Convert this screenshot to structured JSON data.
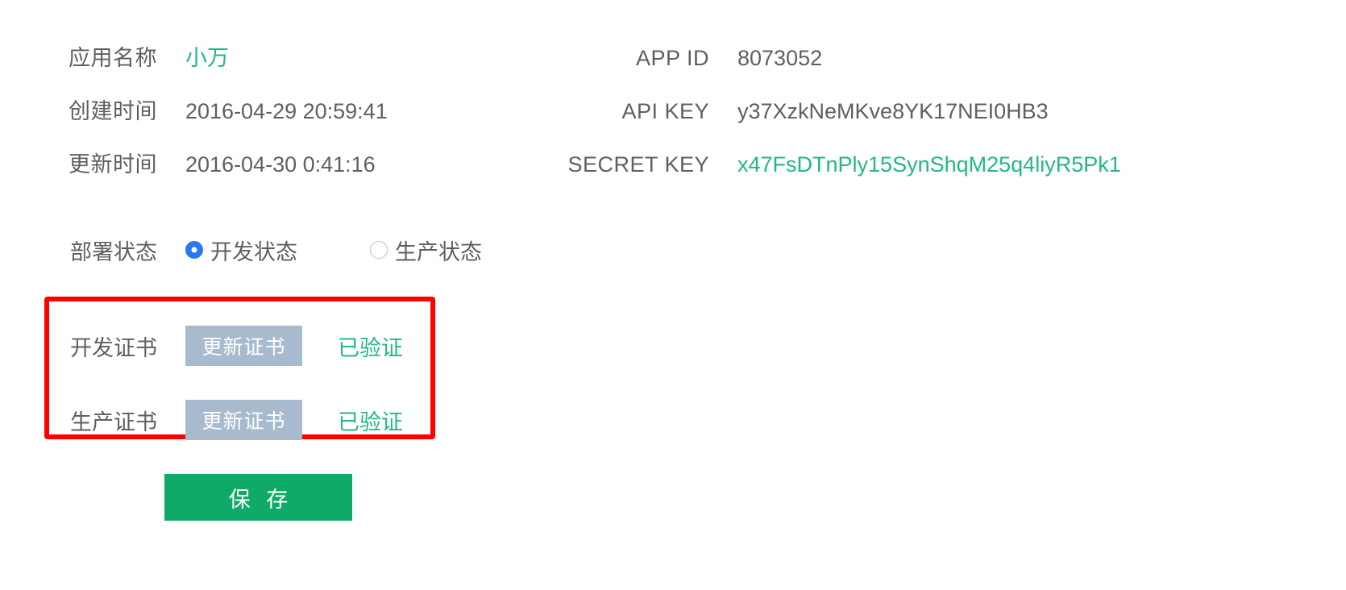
{
  "app_info": {
    "name_label": "应用名称",
    "name_value": "小万",
    "created_label": "创建时间",
    "created_value": "2016-04-29 20:59:41",
    "updated_label": "更新时间",
    "updated_value": "2016-04-30 0:41:16",
    "app_id_label": "APP ID",
    "app_id_value": "8073052",
    "api_key_label": "API KEY",
    "api_key_value": "y37XzkNeMKve8YK17NEI0HB3",
    "secret_key_label": "SECRET KEY",
    "secret_key_value": "x47FsDTnPly15SynShqM25q4liyR5Pk1"
  },
  "deploy": {
    "label": "部署状态",
    "options": [
      {
        "label": "开发状态",
        "selected": true
      },
      {
        "label": "生产状态",
        "selected": false
      }
    ]
  },
  "certificates": {
    "rows": [
      {
        "label": "开发证书",
        "button_label": "更新证书",
        "status": "已验证"
      },
      {
        "label": "生产证书",
        "button_label": "更新证书",
        "status": "已验证"
      }
    ]
  },
  "actions": {
    "save_label": "保 存"
  },
  "colors": {
    "green_accent": "#20b981",
    "save_green": "#0fa968",
    "radio_blue": "#2878f0",
    "cert_button_blue_gray": "#a8bace",
    "highlight_red": "#fe0000",
    "text_gray": "#5f5f5f"
  }
}
